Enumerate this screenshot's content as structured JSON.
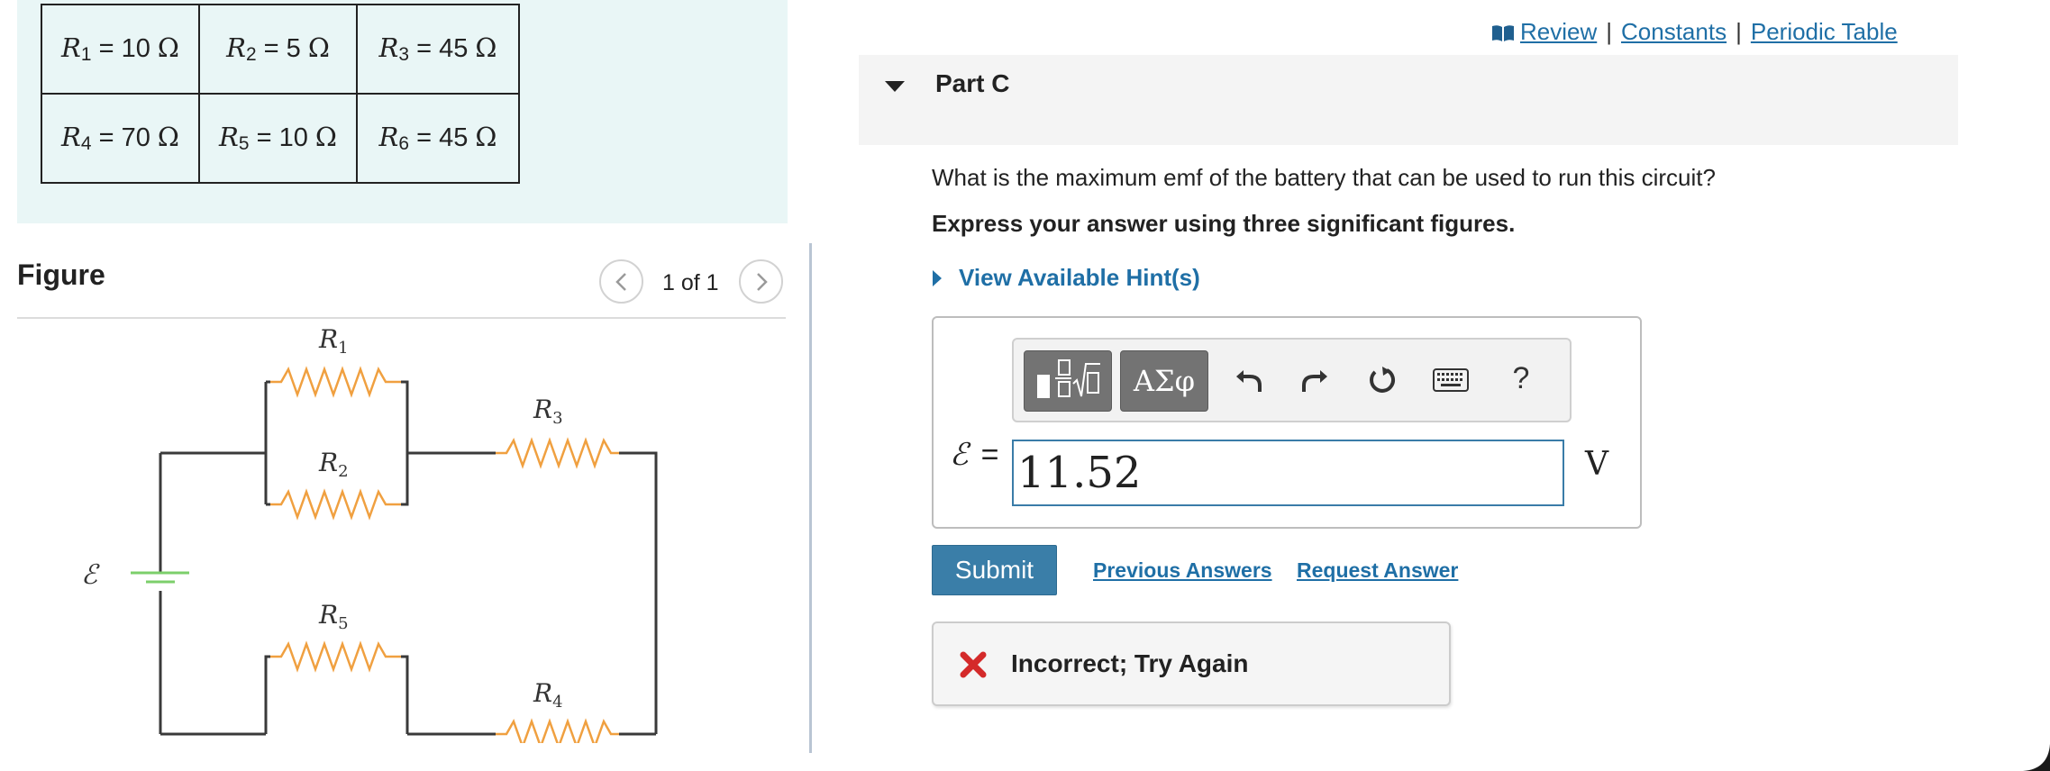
{
  "resistors": [
    [
      {
        "sym": "R",
        "sub": "1",
        "value": " = 10 ",
        "unit": "Ω"
      },
      {
        "sym": "R",
        "sub": "2",
        "value": " = 5 ",
        "unit": "Ω"
      },
      {
        "sym": "R",
        "sub": "3",
        "value": " = 45 ",
        "unit": "Ω"
      }
    ],
    [
      {
        "sym": "R",
        "sub": "4",
        "value": " = 70 ",
        "unit": "Ω"
      },
      {
        "sym": "R",
        "sub": "5",
        "value": " = 10 ",
        "unit": "Ω"
      },
      {
        "sym": "R",
        "sub": "6",
        "value": " = 45 ",
        "unit": "Ω"
      }
    ]
  ],
  "figure": {
    "title": "Figure",
    "counter": "1 of 1",
    "labels": {
      "r1_sym": "R",
      "r1_sub": "1",
      "r2_sym": "R",
      "r2_sub": "2",
      "r3_sym": "R",
      "r3_sub": "3",
      "r4_sym": "R",
      "r4_sub": "4",
      "r5_sym": "R",
      "r5_sub": "5",
      "emf": "ℰ"
    }
  },
  "top_links": {
    "review": "Review",
    "constants": "Constants",
    "periodic_table": "Periodic Table",
    "separator": "|"
  },
  "part": {
    "title": "Part C"
  },
  "question": {
    "text": "What is the maximum emf of the battery that can be used to run this circuit?",
    "instruction": "Express your answer using three significant figures.",
    "hints_label": "View Available Hint(s)"
  },
  "toolbar": {
    "symbols_label": "ΑΣφ",
    "help_label": "?"
  },
  "answer": {
    "variable": "ℰ",
    "equals": "=",
    "value": "11.52",
    "unit": "V"
  },
  "actions": {
    "submit_label": "Submit",
    "previous_answers_label": "Previous Answers",
    "request_answer_label": "Request Answer"
  },
  "feedback": {
    "text": "Incorrect; Try Again"
  },
  "colors": {
    "link": "#1f6fa6",
    "submit_bg": "#3a7ea8",
    "resistor": "#f0a040",
    "battery": "#7ccf6b",
    "error": "#d42a2a",
    "values_bg": "#e9f6f6"
  },
  "icons": {
    "book": "book-icon",
    "caret": "caret-down-icon",
    "hint": "caret-right-icon",
    "incorrect": "x-mark-icon"
  }
}
